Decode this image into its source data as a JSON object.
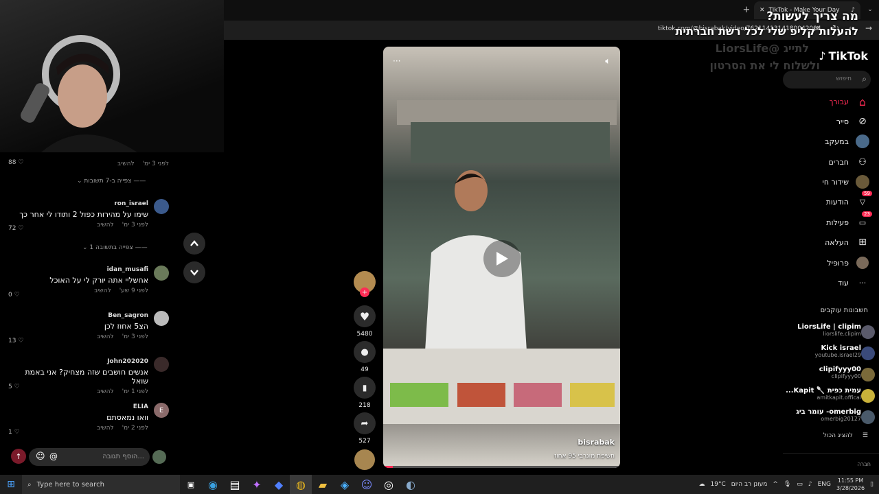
{
  "browser": {
    "tab_title": "TikTok - Make Your Day",
    "url": "tiktok.com/@bisrabak/video/7621141314180042004"
  },
  "overlay": {
    "line1": "מה צריך לעשות?",
    "line2": "להעלות קליפ שלי לכל רשת חברתית",
    "line3": "לתייג @LiorsLife",
    "line4": "ולשלוח לי את הסרטון"
  },
  "comments": {
    "top_item": {
      "time": "לפני 3 ימ'",
      "reply": "להשיב",
      "likes": "88"
    },
    "view_replies_1": "צפייה ב-7 תשובות",
    "items": [
      {
        "user": "ron_israel",
        "text": "שימו על מהירות כפול 2 ותודו לי אחר כך",
        "time": "לפני 3 ימ'",
        "reply": "להשיב",
        "likes": "72"
      },
      {
        "user": "idan_musafi",
        "text": "אחשליי אתה יורק לי על האוכל",
        "time": "לפני 9 שע'",
        "reply": "להשיב",
        "likes": "0"
      },
      {
        "user": "Ben_sagron",
        "text": "הצ5 אחוז לכן",
        "time": "לפני 3 ימ'",
        "reply": "להשיב",
        "likes": "13"
      },
      {
        "user": "John202020",
        "text": "אנשים חושבים שזה מצחיק? אני באמת שואל",
        "time": "לפני 1 ימ'",
        "reply": "להשיב",
        "likes": "5"
      },
      {
        "user": "ELIA",
        "text": "וואו נמאסתם",
        "time": "לפני 2 ימ'",
        "reply": "להשיב",
        "likes": "1"
      }
    ],
    "view_replies_2": "צפייה בתשובה 1",
    "input_placeholder": "הוסף תגובה..."
  },
  "video": {
    "author": "bisrabak",
    "caption": "חשיפת מוגרבי 95 אחוז",
    "likes": "5480",
    "comments": "49",
    "saves": "218",
    "shares": "527"
  },
  "sidebar": {
    "logo": "TikTok",
    "search_placeholder": "חיפוש",
    "nav": [
      {
        "label": "עבורך",
        "icon": "home-icon",
        "active": true
      },
      {
        "label": "סייר",
        "icon": "compass-icon"
      },
      {
        "label": "במעקב",
        "icon": "following-avatar-icon"
      },
      {
        "label": "חברים",
        "icon": "friends-icon"
      },
      {
        "label": "שידור חי",
        "icon": "live-icon"
      },
      {
        "label": "הודעות",
        "icon": "messages-icon",
        "badge": "59"
      },
      {
        "label": "פעילות",
        "icon": "activity-icon",
        "badge": "23"
      },
      {
        "label": "העלאה",
        "icon": "upload-icon"
      },
      {
        "label": "פרופיל",
        "icon": "profile-avatar-icon"
      },
      {
        "label": "עוד",
        "icon": "more-icon"
      }
    ],
    "following_title": "חשבונות עוקבים",
    "accounts": [
      {
        "name": "LiorsLife | clipim",
        "handle": "liorslife.clipim"
      },
      {
        "name": "Kick israel",
        "handle": "youtube.israel29"
      },
      {
        "name": "clipifyyy00",
        "handle": "clipifyyy00"
      },
      {
        "name": "עמית כפית 🥄 Kapit...",
        "handle": "amitkapit.offical"
      },
      {
        "name": "omerbig- עומר ביג",
        "handle": "omerbig20127"
      }
    ],
    "show_all": "להציג הכול",
    "footer": "חברה"
  },
  "taskbar": {
    "search": "Type here to search",
    "weather_temp": "19°C",
    "weather_text": "מעונן רב היום",
    "lang": "ENG",
    "time": "11:55 PM",
    "date": "3/28/2026"
  },
  "colors": {
    "accent": "#fe2c55",
    "bg": "#000000"
  }
}
